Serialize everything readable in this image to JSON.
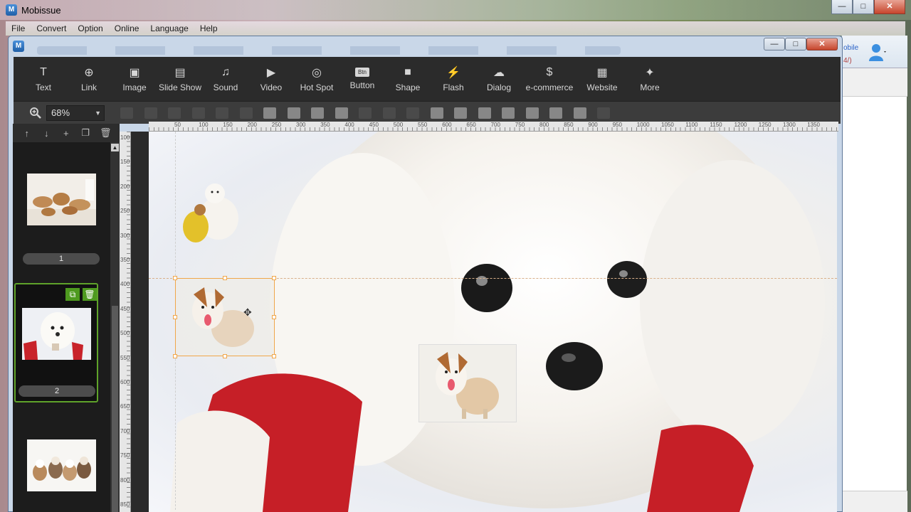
{
  "app": {
    "title": "Mobissue"
  },
  "menu": [
    "File",
    "Convert",
    "Option",
    "Online",
    "Language",
    "Help"
  ],
  "window_buttons": {
    "minimize": "—",
    "maximize": "□",
    "close": "✕"
  },
  "toolbar": [
    {
      "label": "Text",
      "icon": "T"
    },
    {
      "label": "Link",
      "icon": "⊕"
    },
    {
      "label": "Image",
      "icon": "▣"
    },
    {
      "label": "Slide Show",
      "icon": "▤"
    },
    {
      "label": "Sound",
      "icon": "♫"
    },
    {
      "label": "Video",
      "icon": "▶"
    },
    {
      "label": "Hot Spot",
      "icon": "◎"
    },
    {
      "label": "Button",
      "icon": "Btn"
    },
    {
      "label": "Shape",
      "icon": "■"
    },
    {
      "label": "Flash",
      "icon": "⚡"
    },
    {
      "label": "Dialog",
      "icon": "☁"
    },
    {
      "label": "e-commerce",
      "icon": "$"
    },
    {
      "label": "Website",
      "icon": "▦"
    },
    {
      "label": "More",
      "icon": "✦"
    }
  ],
  "zoom": {
    "value": "68%"
  },
  "panel": {
    "actions": [
      "↑",
      "↓",
      "+",
      "❐",
      "🗑"
    ],
    "pages": [
      {
        "number": "1"
      },
      {
        "number": "2"
      }
    ]
  },
  "ruler": {
    "top": [
      "50",
      "100",
      "150",
      "200",
      "250",
      "300",
      "350",
      "400",
      "450",
      "500",
      "550",
      "600",
      "650",
      "700",
      "750",
      "800",
      "850",
      "900",
      "950",
      "1000",
      "1050",
      "1100",
      "1150",
      "1200",
      "1250",
      "1300",
      "1350"
    ],
    "left": [
      "100",
      "150",
      "200",
      "250",
      "300",
      "350",
      "400",
      "450",
      "500",
      "550",
      "600",
      "650",
      "700",
      "750",
      "800",
      "850"
    ]
  },
  "right_panel": {
    "text1": "obile",
    "text2": "4/)"
  }
}
